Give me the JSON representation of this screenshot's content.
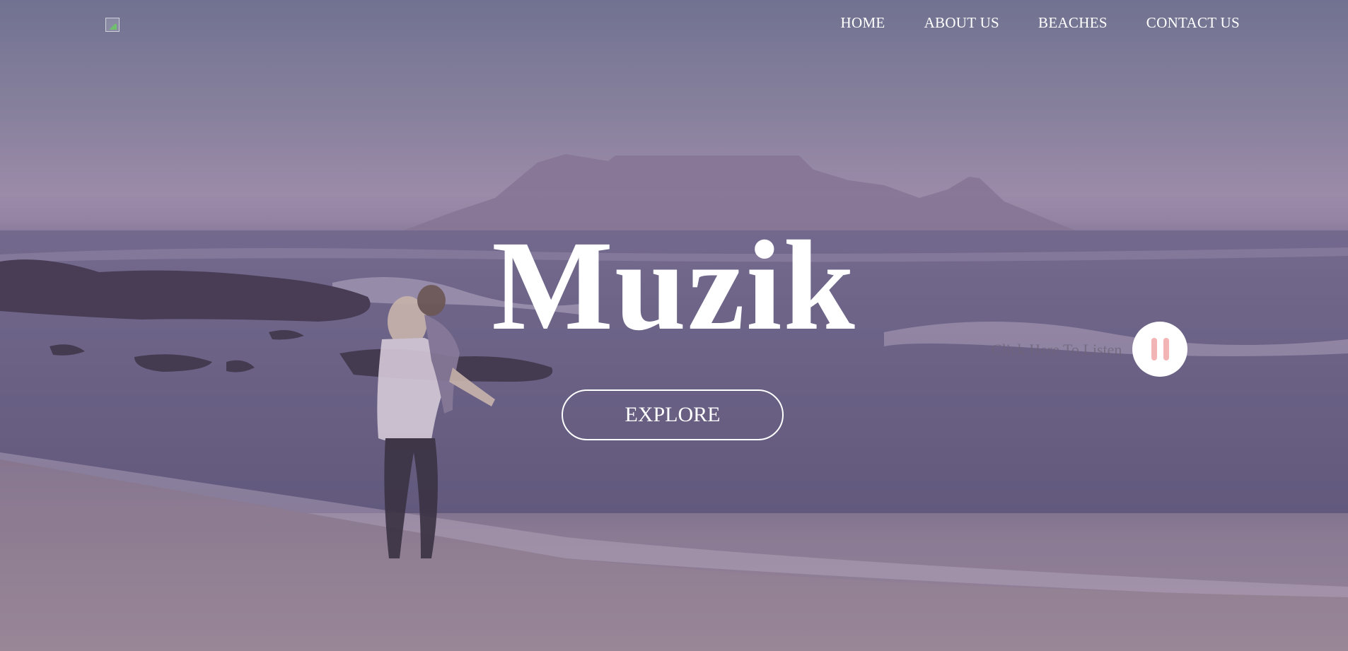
{
  "nav": {
    "items": [
      {
        "label": "HOME"
      },
      {
        "label": "ABOUT US"
      },
      {
        "label": "BEACHES"
      },
      {
        "label": "CONTACT US"
      }
    ]
  },
  "hero": {
    "title": "Muzik",
    "explore_label": "EXPLORE",
    "listen_label": "Click Here To Listen",
    "audio_button_icon": "pause-icon"
  },
  "colors": {
    "text": "#ffffff",
    "pause_icon": "#f3b4b6"
  }
}
